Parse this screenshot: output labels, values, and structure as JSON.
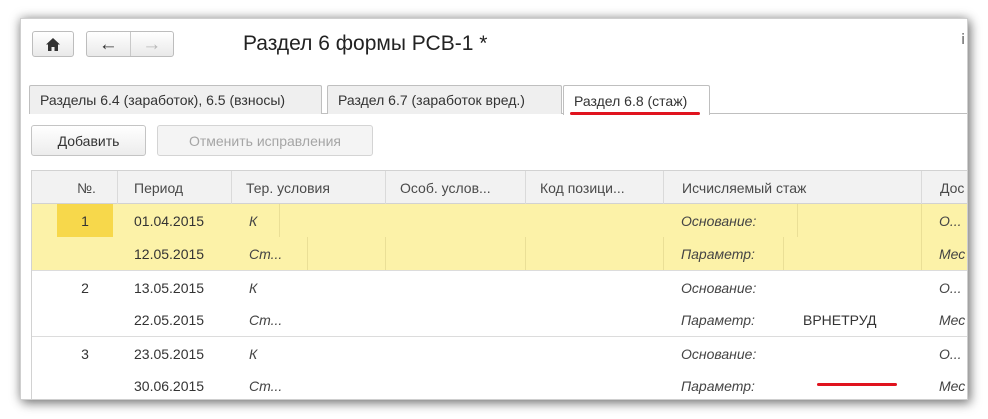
{
  "window": {
    "title": "Раздел 6 формы РСВ-1 *",
    "corner_mark": "ⅰ"
  },
  "nav": {
    "home_icon": "home-icon",
    "back_icon": "arrow-left-icon",
    "forward_icon": "arrow-right-icon"
  },
  "tabs": [
    {
      "label": "Разделы 6.4 (заработок), 6.5 (взносы)",
      "active": false
    },
    {
      "label": "Раздел 6.7 (заработок вред.)",
      "active": false
    },
    {
      "label": "Раздел 6.8 (стаж)",
      "active": true
    }
  ],
  "commands": {
    "add": "Добавить",
    "cancel_fixes": "Отменить исправления"
  },
  "columns": {
    "num": "№.",
    "period": "Период",
    "ter": "Тер. условия",
    "osob": "Особ. услов...",
    "kod": "Код позици...",
    "stazh": "Исчисляемый стаж",
    "dos": "Дос"
  },
  "rows": [
    {
      "num": "1",
      "period": "01.04.2015",
      "ter": "К",
      "stazh_label": "Основание:",
      "stazh_value": "",
      "dos": "О..."
    },
    {
      "num": "",
      "period": "12.05.2015",
      "ter": "Ст...",
      "stazh_label": "Параметр:",
      "stazh_value": "",
      "dos": "Мес"
    },
    {
      "num": "2",
      "period": "13.05.2015",
      "ter": "К",
      "stazh_label": "Основание:",
      "stazh_value": "",
      "dos": "О..."
    },
    {
      "num": "",
      "period": "22.05.2015",
      "ter": "Ст...",
      "stazh_label": "Параметр:",
      "stazh_value": "ВРНЕТРУД",
      "dos": "Мес"
    },
    {
      "num": "3",
      "period": "23.05.2015",
      "ter": "К",
      "stazh_label": "Основание:",
      "stazh_value": "",
      "dos": "О..."
    },
    {
      "num": "",
      "period": "30.06.2015",
      "ter": "Ст...",
      "stazh_label": "Параметр:",
      "stazh_value": "",
      "dos": "Мес"
    }
  ],
  "colors": {
    "selected_row": "#fcf2a8",
    "selected_num": "#f7d84b",
    "annotation_red": "#e0131e"
  }
}
